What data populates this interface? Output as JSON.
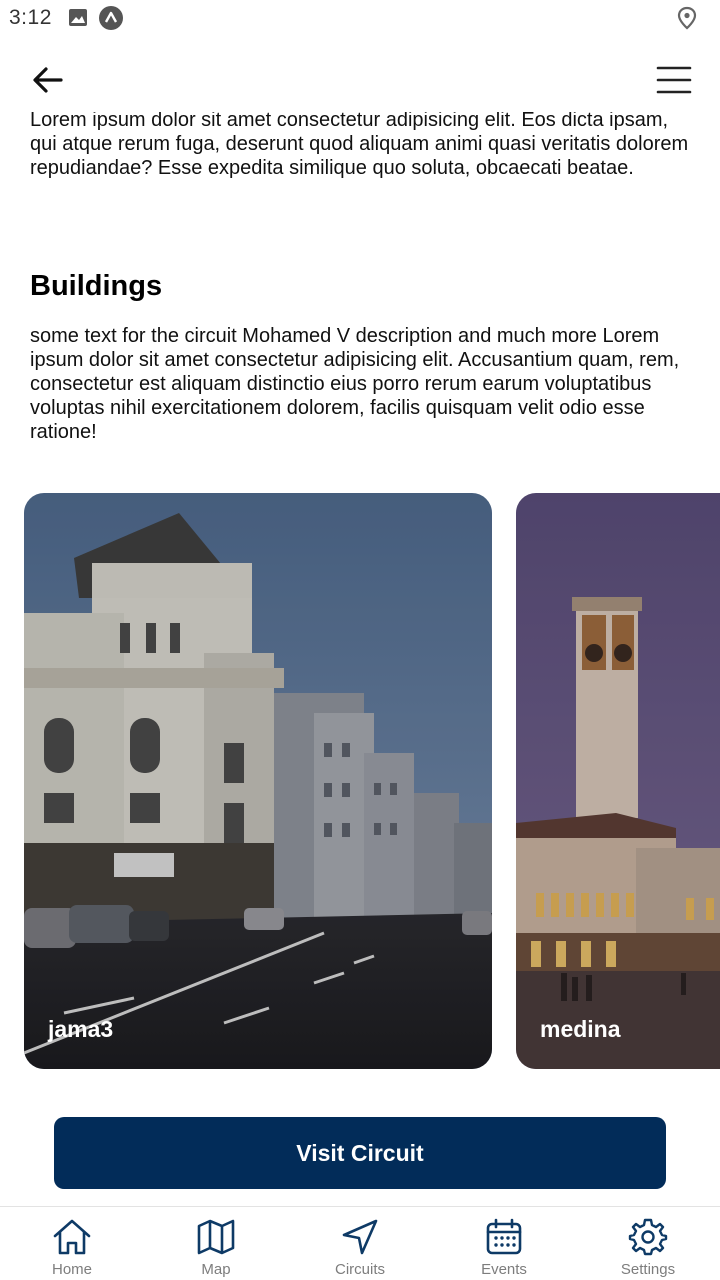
{
  "status_bar": {
    "time": "3:12",
    "icons": [
      "image-icon",
      "app-notification-icon",
      "location-pin-icon"
    ]
  },
  "header": {
    "back_icon": "arrow-left-icon",
    "menu_icon": "hamburger-menu-icon"
  },
  "content": {
    "intro_text": "Lorem ipsum dolor sit amet consectetur adipisicing elit. Eos dicta ipsam, qui atque rerum fuga, deserunt quod aliquam animi quasi veritatis dolorem repudiandae? Esse expedita similique quo soluta, obcaecati beatae.",
    "buildings_heading": "Buildings",
    "buildings_text": "some text for the circuit Mohamed V description and much more Lorem ipsum dolor sit amet consectetur adipisicing elit. Accusantium quam, rem, consectetur est aliquam distinctio eius porro rerum earum voluptatibus voluptas nihil exercitationem dolorem, facilis quisquam velit odio esse ratione!"
  },
  "carousel": {
    "cards": [
      {
        "label": "jama3"
      },
      {
        "label": "medina"
      }
    ]
  },
  "cta": {
    "label": "Visit Circuit"
  },
  "bottom_nav": {
    "items": [
      {
        "label": "Home",
        "icon": "home-icon",
        "active": true
      },
      {
        "label": "Map",
        "icon": "map-icon",
        "active": true
      },
      {
        "label": "Circuits",
        "icon": "navigation-arrow-icon",
        "active": true
      },
      {
        "label": "Events",
        "icon": "calendar-icon",
        "active": true
      },
      {
        "label": "Settings",
        "icon": "gear-icon",
        "active": true
      }
    ]
  },
  "colors": {
    "primary": "#022c59",
    "nav_icon": "#0e3a66",
    "nav_label": "#7d7d7d",
    "text": "#111111"
  }
}
